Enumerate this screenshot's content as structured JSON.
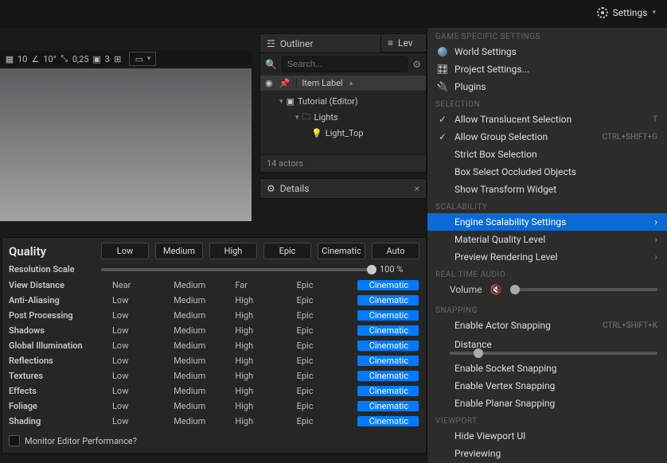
{
  "topbar": {
    "settings_label": "Settings"
  },
  "viewport_toolbar": {
    "grid_snap": "10",
    "angle_snap": "10°",
    "scale_snap": "0,25",
    "camera_speed": "3"
  },
  "outliner": {
    "title": "Outliner",
    "search_placeholder": "Search...",
    "header_label": "Item Label",
    "items": [
      {
        "label": "Tutorial (Editor)"
      },
      {
        "label": "Lights"
      },
      {
        "label": "Light_Top"
      }
    ],
    "footer": "14 actors"
  },
  "lev_tab": {
    "label": "Lev"
  },
  "details": {
    "title": "Details"
  },
  "quality": {
    "title": "Quality",
    "top_buttons": [
      "Low",
      "Medium",
      "High",
      "Epic",
      "Cinematic",
      "Auto"
    ],
    "resolution_label": "Resolution Scale",
    "resolution_value": "100 %",
    "rows": [
      {
        "label": "View Distance",
        "opts": [
          "Near",
          "Medium",
          "Far",
          "Epic",
          "Cinematic"
        ],
        "sel": 4
      },
      {
        "label": "Anti-Aliasing",
        "opts": [
          "Low",
          "Medium",
          "High",
          "Epic",
          "Cinematic"
        ],
        "sel": 4
      },
      {
        "label": "Post Processing",
        "opts": [
          "Low",
          "Medium",
          "High",
          "Epic",
          "Cinematic"
        ],
        "sel": 4
      },
      {
        "label": "Shadows",
        "opts": [
          "Low",
          "Medium",
          "High",
          "Epic",
          "Cinematic"
        ],
        "sel": 4
      },
      {
        "label": "Global Illumination",
        "opts": [
          "Low",
          "Medium",
          "High",
          "Epic",
          "Cinematic"
        ],
        "sel": 4
      },
      {
        "label": "Reflections",
        "opts": [
          "Low",
          "Medium",
          "High",
          "Epic",
          "Cinematic"
        ],
        "sel": 4
      },
      {
        "label": "Textures",
        "opts": [
          "Low",
          "Medium",
          "High",
          "Epic",
          "Cinematic"
        ],
        "sel": 4
      },
      {
        "label": "Effects",
        "opts": [
          "Low",
          "Medium",
          "High",
          "Epic",
          "Cinematic"
        ],
        "sel": 4
      },
      {
        "label": "Foliage",
        "opts": [
          "Low",
          "Medium",
          "High",
          "Epic",
          "Cinematic"
        ],
        "sel": 4
      },
      {
        "label": "Shading",
        "opts": [
          "Low",
          "Medium",
          "High",
          "Epic",
          "Cinematic"
        ],
        "sel": 4
      }
    ],
    "monitor_label": "Monitor Editor Performance?"
  },
  "settings_menu": {
    "sections": {
      "game": {
        "header": "GAME SPECIFIC SETTINGS",
        "items": [
          {
            "label": "World Settings"
          },
          {
            "label": "Project Settings..."
          },
          {
            "label": "Plugins"
          }
        ]
      },
      "selection": {
        "header": "SELECTION",
        "items": [
          {
            "label": "Allow Translucent Selection",
            "checked": true,
            "shortcut": "T"
          },
          {
            "label": "Allow Group Selection",
            "checked": true,
            "shortcut": "CTRL+SHIFT+G"
          },
          {
            "label": "Strict Box Selection"
          },
          {
            "label": "Box Select Occluded Objects"
          },
          {
            "label": "Show Transform Widget"
          }
        ]
      },
      "scalability": {
        "header": "SCALABILITY",
        "items": [
          {
            "label": "Engine Scalability Settings",
            "submenu": true,
            "highlight": true
          },
          {
            "label": "Material Quality Level",
            "submenu": true
          },
          {
            "label": "Preview Rendering Level",
            "submenu": true
          }
        ]
      },
      "audio": {
        "header": "REAL TIME AUDIO",
        "volume_label": "Volume"
      },
      "snapping": {
        "header": "SNAPPING",
        "items": [
          {
            "label": "Enable Actor Snapping",
            "shortcut": "CTRL+SHIFT+K"
          },
          {
            "label_distance": "Distance"
          },
          {
            "label": "Enable Socket Snapping"
          },
          {
            "label": "Enable Vertex Snapping"
          },
          {
            "label": "Enable Planar Snapping"
          }
        ]
      },
      "viewport": {
        "header": "VIEWPORT",
        "items": [
          {
            "label": "Hide Viewport UI"
          },
          {
            "label": "Previewing"
          }
        ]
      }
    }
  }
}
